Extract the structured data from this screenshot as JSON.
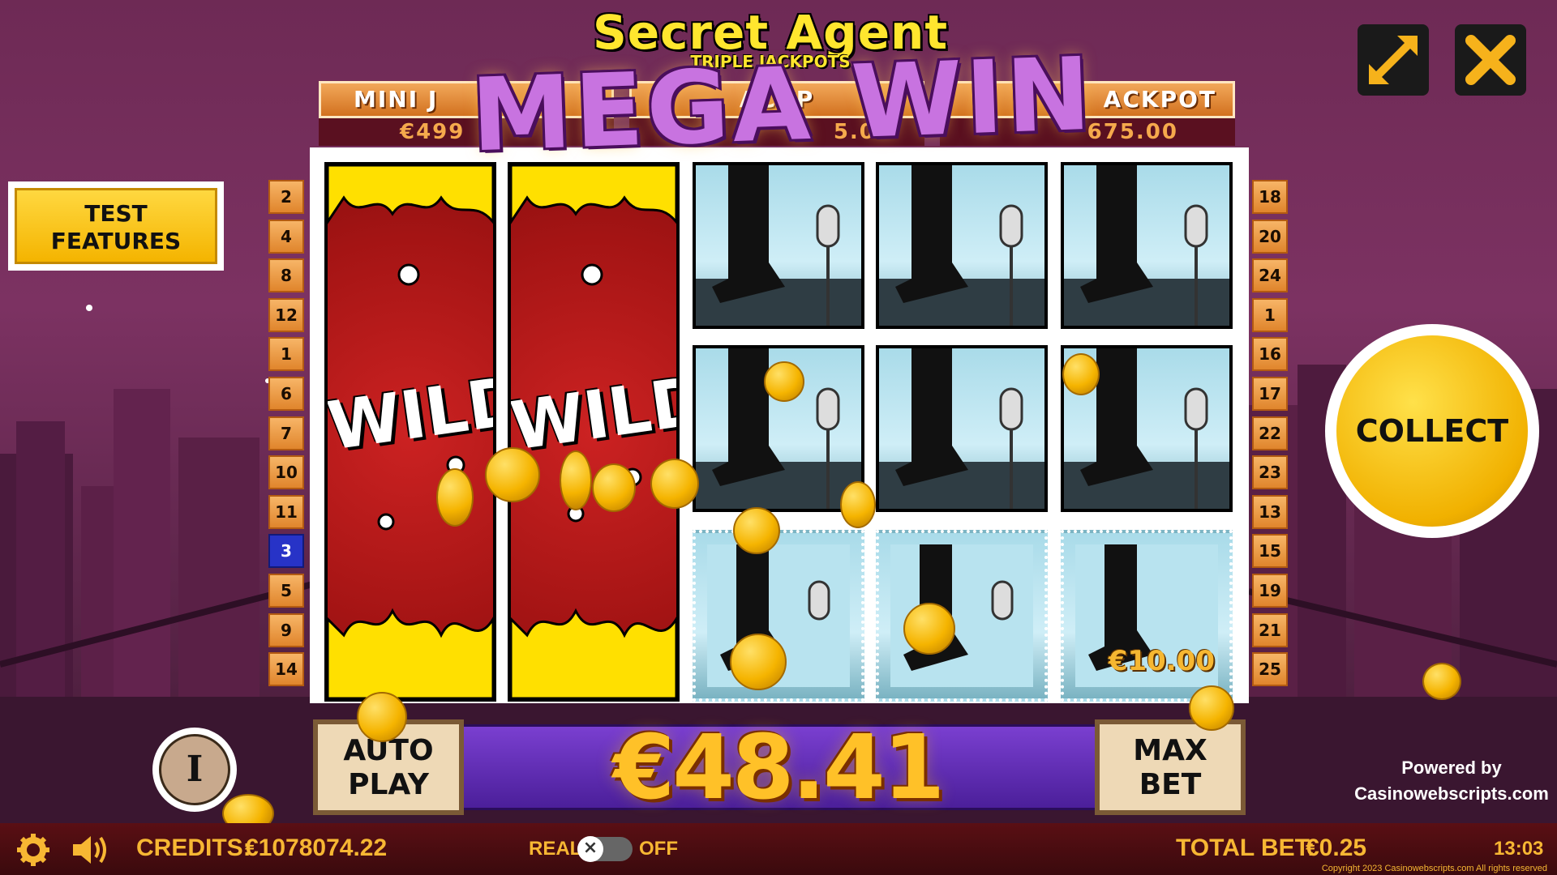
{
  "game": {
    "title": "Secret Agent",
    "subtitle": "TRIPLE JACKPOTS",
    "banner": "MEGA WIN"
  },
  "jackpots": [
    {
      "label": "MINI J",
      "value": "€499"
    },
    {
      "label": "ACKP",
      "value": "5.00"
    },
    {
      "label": "ACKPOT",
      "value": "675.00"
    }
  ],
  "paylines": {
    "left": [
      "2",
      "4",
      "8",
      "12",
      "1",
      "6",
      "7",
      "10",
      "11",
      "3",
      "5",
      "9",
      "14"
    ],
    "right": [
      "18",
      "20",
      "24",
      "1",
      "16",
      "17",
      "22",
      "23",
      "13",
      "15",
      "19",
      "21",
      "25"
    ],
    "active_left_index": 9
  },
  "reels": {
    "wild_label": "WILD",
    "cell_value": "€10.00"
  },
  "buttons": {
    "test_features": "TEST FEATURES",
    "collect": "COLLECT",
    "auto_play": "AUTO PLAY",
    "max_bet": "MAX BET",
    "info": "I"
  },
  "win": {
    "amount": "€48.41"
  },
  "footer": {
    "credits_label": "CREDITS:",
    "credits_value": "€1078074.22",
    "real_label": "REAL",
    "off_label": "OFF",
    "total_bet_label": "TOTAL BET:",
    "total_bet_value": "€0.25",
    "time": "13:03",
    "copyright": "Copyright 2023 Casinowebscripts.com All rights reserved"
  },
  "powered": {
    "line1": "Powered by",
    "line2": "Casinowebscripts.com"
  },
  "colors": {
    "accent_gold": "#f7b733",
    "wild_red": "#a41414",
    "win_purple": "#5a2aa8"
  }
}
